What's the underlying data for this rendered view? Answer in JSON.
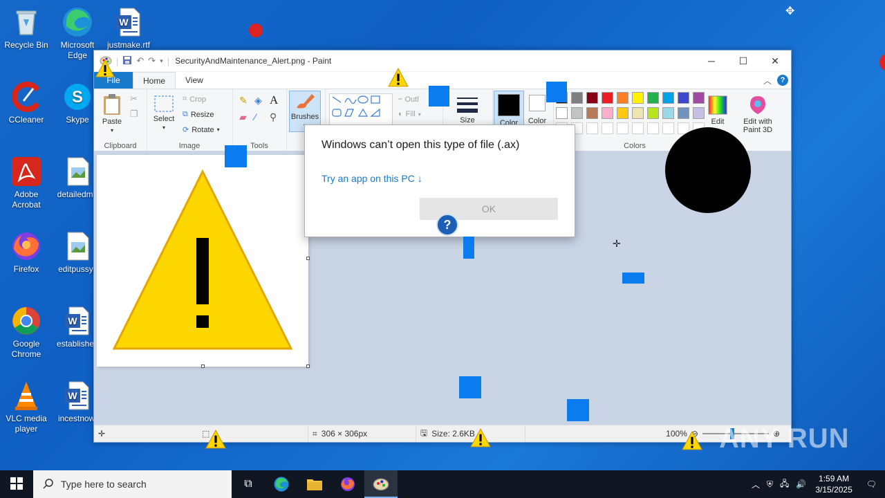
{
  "desktop": {
    "icons": [
      {
        "label": "Recycle Bin"
      },
      {
        "label": "Microsoft Edge",
        "line1": "Microsoft",
        "line2": "Edge"
      },
      {
        "label": "justmake.rtf"
      },
      {
        "label": "CCleaner"
      },
      {
        "label": "Skype"
      },
      {
        "label": "Adobe Acrobat",
        "line1": "Adobe",
        "line2": "Acrobat"
      },
      {
        "label": "detailedma"
      },
      {
        "label": "Firefox"
      },
      {
        "label": "editpussy.j"
      },
      {
        "label": "Google Chrome",
        "line1": "Google",
        "line2": "Chrome"
      },
      {
        "label": "establishec"
      },
      {
        "label": "VLC media player",
        "line1": "VLC media",
        "line2": "player"
      },
      {
        "label": "incestnow."
      }
    ]
  },
  "paint": {
    "title": "SecurityAndMaintenance_Alert.png - Paint",
    "tabs": {
      "file": "File",
      "home": "Home",
      "view": "View"
    },
    "ribbon": {
      "clipboard": {
        "paste": "Paste",
        "group": "Clipboard"
      },
      "image": {
        "select": "Select",
        "crop": "Crop",
        "resize": "Resize",
        "rotate": "Rotate",
        "group": "Image"
      },
      "tools": {
        "group": "Tools"
      },
      "brushes": {
        "label": "Brushes"
      },
      "shapes": {
        "outline": "Outl",
        "fill": "Fill"
      },
      "size": {
        "label": "Size"
      },
      "color1": {
        "label": "Color"
      },
      "color2": {
        "label": "Color"
      },
      "colors": {
        "group": "Colors"
      },
      "edit_colors": {
        "label1": "Edit"
      },
      "paint3d": {
        "line1": "Edit with",
        "line2": "Paint 3D"
      }
    },
    "palette": [
      "#000000",
      "#7f7f7f",
      "#880015",
      "#ed1c24",
      "#ff7f27",
      "#fff200",
      "#22b14c",
      "#00a2e8",
      "#3f48cc",
      "#a349a4",
      "#ffffff",
      "#c3c3c3",
      "#b97a57",
      "#ffaec9",
      "#ffc90e",
      "#efe4b0",
      "#b5e61d",
      "#99d9ea",
      "#7092be",
      "#c8bfe7"
    ],
    "status": {
      "size": "306 × 306px",
      "filesize": "Size: 2.6KB",
      "zoom": "100%"
    }
  },
  "dialog": {
    "heading": "Windows can’t open this type of file (.ax)",
    "link": "Try an app on this PC ↓",
    "ok": "OK"
  },
  "taskbar": {
    "search_placeholder": "Type here to search",
    "time": "1:59 AM",
    "date": "3/15/2025"
  },
  "watermark": "ANY RUN",
  "colors": {
    "accent": "#1979ca",
    "warning_yellow": "#ffd700"
  }
}
